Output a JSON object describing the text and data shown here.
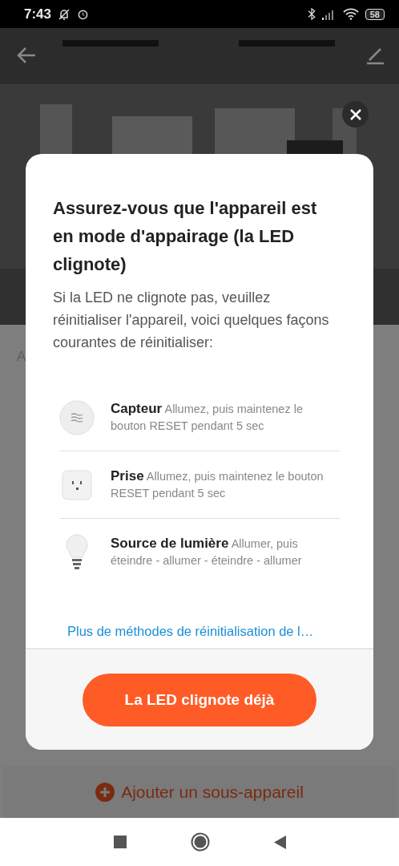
{
  "status_bar": {
    "time": "7:43",
    "battery": "58"
  },
  "page": {
    "section_label": "A",
    "add_button": {
      "label": "Ajouter un sous-appareil"
    }
  },
  "dialog": {
    "title": "Assurez-vous que l'appareil est en mode d'appairage (la LED clignote)",
    "body": "Si la LED ne clignote pas, veuillez réinitialiser l'appareil, voici quelques façons courantes de réinitialiser:",
    "methods": [
      {
        "kind": "sensor",
        "name": "Capteur",
        "text": "Allumez, puis maintenez le bouton RESET pendant 5 sec"
      },
      {
        "kind": "plug",
        "name": "Prise",
        "text": "Allumez, puis maintenez le bouton RESET pendant 5 sec"
      },
      {
        "kind": "bulb",
        "name": "Source de lumière",
        "text": "Allumer, puis éteindre - allumer - éteindre - allumer"
      }
    ],
    "link": "Plus de méthodes de réinitialisation de l…",
    "button": "La LED clignote déjà"
  }
}
